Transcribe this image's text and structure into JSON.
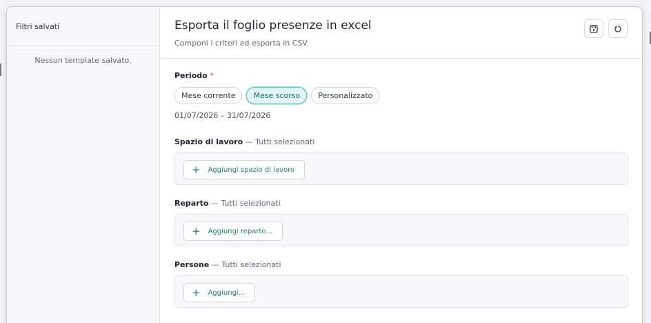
{
  "sidebar": {
    "title": "Filtri salvati",
    "empty_text": "Nessun template salvato."
  },
  "header": {
    "title": "Esporta il foglio presenze in excel",
    "subtitle": "Componi i criteri ed esporta in CSV",
    "save_icon": "floppy-disk-icon",
    "reset_icon": "refresh-icon"
  },
  "period": {
    "label": "Periodo",
    "required_mark": "*",
    "options": [
      "Mese corrente",
      "Mese scorso",
      "Personalizzato"
    ],
    "selected": "Mese scorso",
    "range": "01/07/2026 – 31/07/2026"
  },
  "workspace": {
    "label": "Spazio di lavoro",
    "status": "— Tutti selezionati",
    "add_label": "Aggiungi spazio di lavoro"
  },
  "department": {
    "label": "Reparto",
    "status": "— Tutti selezionati",
    "add_label": "Aggiungi reparto..."
  },
  "people": {
    "label": "Persone",
    "status": "— Tutti selezionati",
    "add_label": "Aggiungi..."
  },
  "colors": {
    "accent": "#13706b",
    "accent_bg": "#e3f6f5",
    "required": "#e0443a"
  }
}
